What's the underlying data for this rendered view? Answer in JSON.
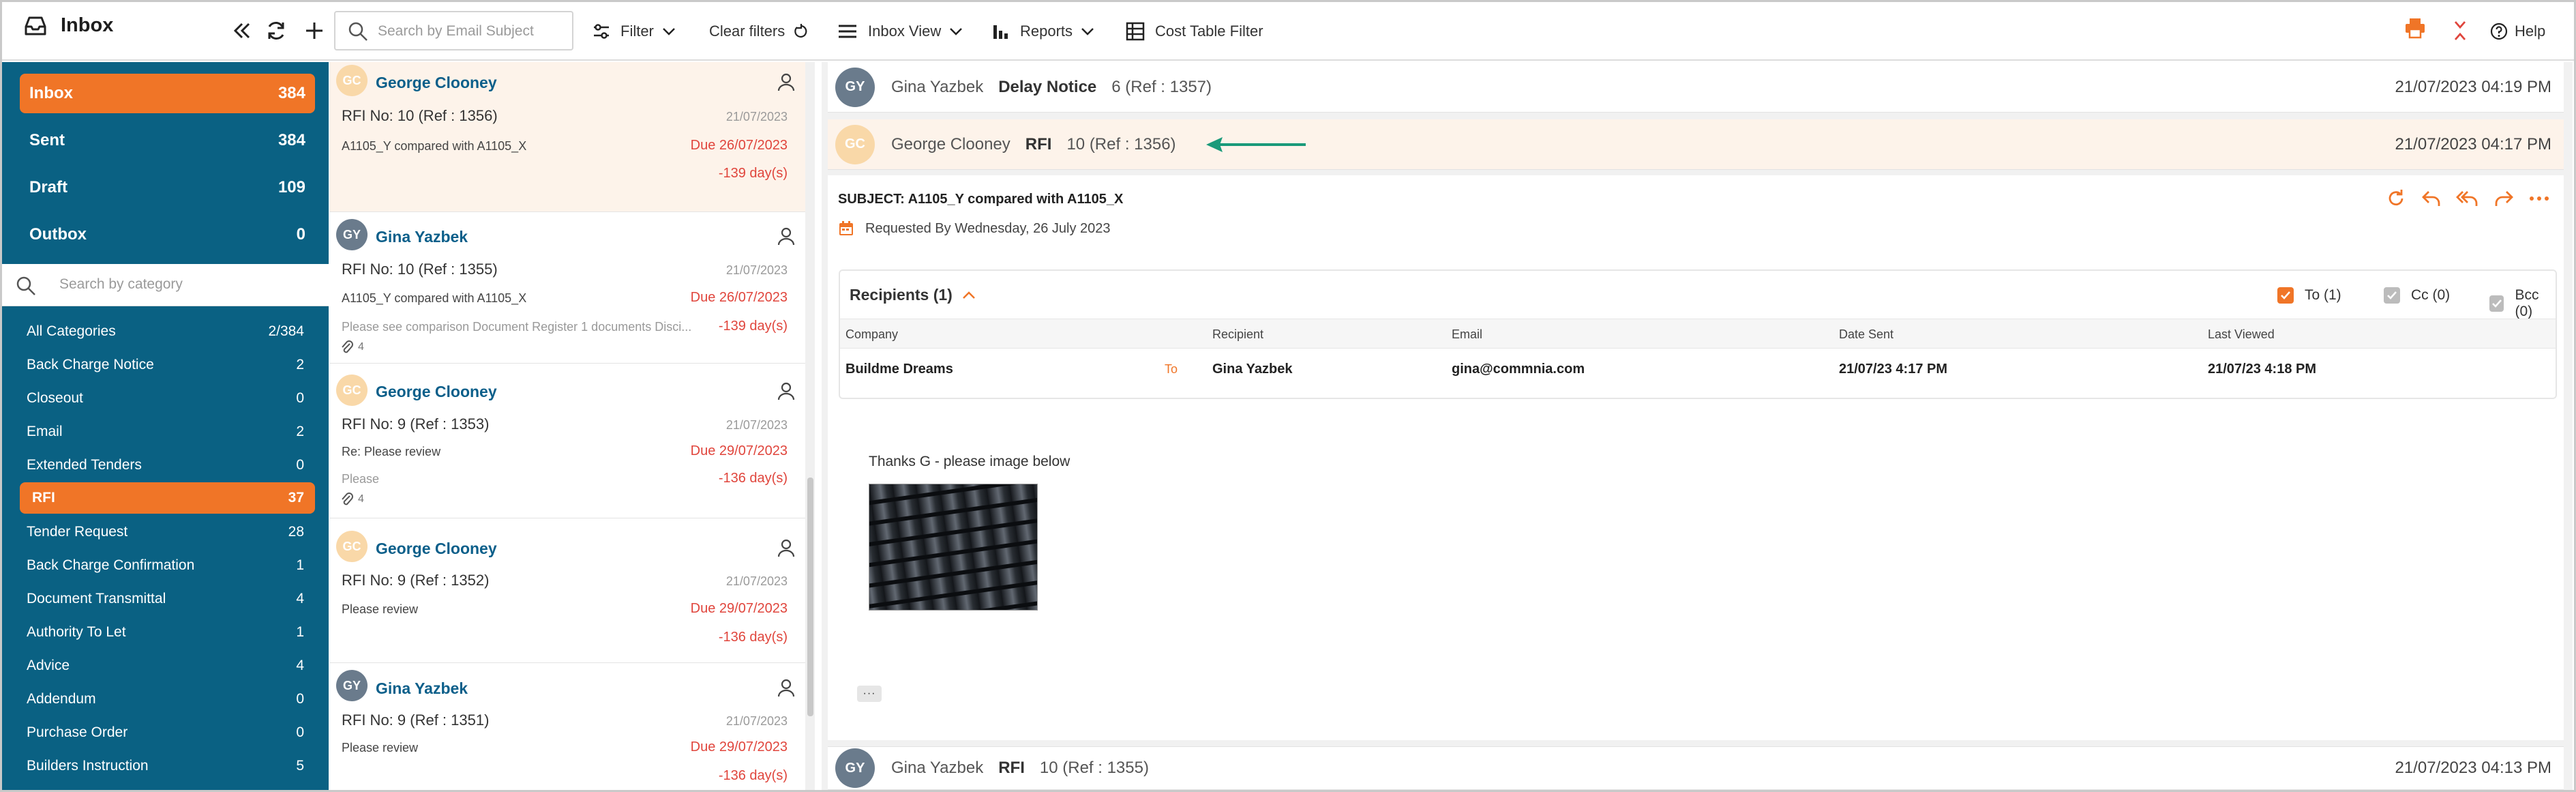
{
  "toolbar": {
    "title": "Inbox",
    "search_placeholder": "Search by Email Subject",
    "filter_label": "Filter",
    "clear_filters_label": "Clear filters",
    "inbox_view_label": "Inbox View",
    "reports_label": "Reports",
    "cost_table_filter_label": "Cost Table Filter",
    "help_label": "Help"
  },
  "sidebar": {
    "folders": [
      {
        "label": "Inbox",
        "count": "384",
        "active": true
      },
      {
        "label": "Sent",
        "count": "384"
      },
      {
        "label": "Draft",
        "count": "109"
      },
      {
        "label": "Outbox",
        "count": "0"
      }
    ],
    "category_search_placeholder": "Search by category",
    "categories": [
      {
        "label": "All Categories",
        "count": "2/384"
      },
      {
        "label": "Back Charge Notice",
        "count": "2"
      },
      {
        "label": "Closeout",
        "count": "0"
      },
      {
        "label": "Email",
        "count": "2"
      },
      {
        "label": "Extended Tenders",
        "count": "0"
      },
      {
        "label": "RFI",
        "count": "37",
        "active": true
      },
      {
        "label": "Tender Request",
        "count": "28"
      },
      {
        "label": "Back Charge Confirmation",
        "count": "1"
      },
      {
        "label": "Document Transmittal",
        "count": "4"
      },
      {
        "label": "Authority To Let",
        "count": "1"
      },
      {
        "label": "Advice",
        "count": "4"
      },
      {
        "label": "Addendum",
        "count": "0"
      },
      {
        "label": "Purchase Order",
        "count": "0"
      },
      {
        "label": "Builders Instruction",
        "count": "5"
      }
    ]
  },
  "messages": [
    {
      "initials": "GC",
      "name": "George Clooney",
      "subject": "RFI No: 10 (Ref : 1356)",
      "date": "21/07/2023",
      "preview": "A1105_Y compared with A1105_X",
      "preview2": "",
      "due": "Due 26/07/2023",
      "days": "-139 day(s)",
      "attachments": ""
    },
    {
      "initials": "GY",
      "name": "Gina Yazbek",
      "subject": "RFI No: 10 (Ref : 1355)",
      "date": "21/07/2023",
      "preview": "A1105_Y compared with A1105_X",
      "preview2": "Please see comparison Document Register 1 documents Disci...",
      "due": "Due 26/07/2023",
      "days": "-139 day(s)",
      "attachments": "4"
    },
    {
      "initials": "GC",
      "name": "George Clooney",
      "subject": "RFI No: 9 (Ref : 1353)",
      "date": "21/07/2023",
      "preview": "Re: Please review",
      "preview2": "Please",
      "due": "Due 29/07/2023",
      "days": "-136 day(s)",
      "attachments": "4"
    },
    {
      "initials": "GC",
      "name": "George Clooney",
      "subject": "RFI No: 9 (Ref : 1352)",
      "date": "21/07/2023",
      "preview": "Please review",
      "preview2": "",
      "due": "Due 29/07/2023",
      "days": "-136 day(s)",
      "attachments": ""
    },
    {
      "initials": "GY",
      "name": "Gina Yazbek",
      "subject": "RFI No: 9 (Ref : 1351)",
      "date": "21/07/2023",
      "preview": "Please review",
      "preview2": "",
      "due": "Due 29/07/2023",
      "days": "-136 day(s)",
      "attachments": ""
    }
  ],
  "detail": {
    "threads": [
      {
        "initials": "GY",
        "from": "Gina Yazbek",
        "type": "Delay Notice",
        "number": "6 (Ref : 1357)",
        "date": "21/07/2023 04:19 PM"
      },
      {
        "initials": "GC",
        "from": "George Clooney",
        "type": "RFI",
        "number": "10 (Ref : 1356)",
        "date": "21/07/2023 04:17 PM"
      },
      {
        "initials": "GY",
        "from": "Gina Yazbek",
        "type": "RFI",
        "number": "10 (Ref : 1355)",
        "date": "21/07/2023 04:13 PM"
      }
    ],
    "subject": "SUBJECT: A1105_Y compared with A1105_X",
    "requested_by": "Requested By Wednesday, 26 July 2023",
    "recipients": {
      "title": "Recipients (1)",
      "to_label": "To (1)",
      "cc_label": "Cc (0)",
      "bcc_label": "Bcc (0)",
      "columns": [
        "Company",
        "Recipient",
        "Email",
        "Date Sent",
        "Last Viewed"
      ],
      "rows": [
        {
          "company": "Buildme Dreams",
          "tag": "To",
          "recipient": "Gina Yazbek",
          "email": "gina@commnia.com",
          "date_sent": "21/07/23 4:17 PM",
          "last_viewed": "21/07/23 4:18 PM"
        }
      ]
    },
    "message_text": "Thanks G - please image below",
    "more_label": "···"
  },
  "colors": {
    "accent": "#f07527",
    "sidebar": "#0a6183",
    "link": "#0b5f8a",
    "due": "#e0453c",
    "arrow": "#1a9a7a"
  }
}
